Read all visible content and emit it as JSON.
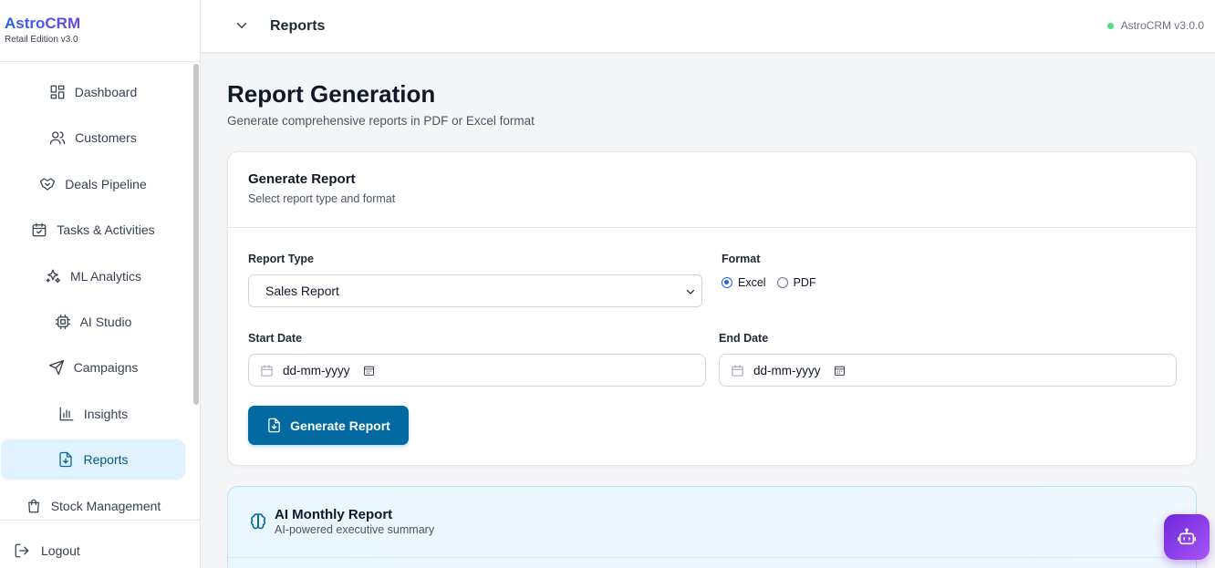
{
  "brand": {
    "title": "AstroCRM",
    "edition": "Retail Edition v3.0"
  },
  "sidebar": {
    "items": [
      {
        "label": "Dashboard",
        "icon": "dashboard-icon",
        "active": false
      },
      {
        "label": "Customers",
        "icon": "users-icon",
        "active": false
      },
      {
        "label": "Deals Pipeline",
        "icon": "handshake-icon",
        "active": false
      },
      {
        "label": "Tasks & Activities",
        "icon": "calendar-check-icon",
        "active": false
      },
      {
        "label": "ML Analytics",
        "icon": "sparkles-icon",
        "active": false
      },
      {
        "label": "AI Studio",
        "icon": "cpu-icon",
        "active": false
      },
      {
        "label": "Campaigns",
        "icon": "send-icon",
        "active": false
      },
      {
        "label": "Insights",
        "icon": "bar-chart-icon",
        "active": false
      },
      {
        "label": "Reports",
        "icon": "file-download-icon",
        "active": true
      },
      {
        "label": "Stock Management",
        "icon": "shopping-bag-icon",
        "active": false
      }
    ],
    "logout_label": "Logout"
  },
  "header": {
    "title": "Reports",
    "version": "AstroCRM v3.0.0",
    "status_color": "#4ade80"
  },
  "page": {
    "title": "Report Generation",
    "subtitle": "Generate comprehensive reports in PDF or Excel format"
  },
  "generate_card": {
    "title": "Generate Report",
    "subtitle": "Select report type and format",
    "report_type_label": "Report Type",
    "report_type_value": "Sales Report",
    "format_label": "Format",
    "format_options": [
      {
        "label": "Excel",
        "checked": true
      },
      {
        "label": "PDF",
        "checked": false
      }
    ],
    "start_date_label": "Start Date",
    "start_date_placeholder": "dd-mm-yyyy",
    "end_date_label": "End Date",
    "end_date_placeholder": "dd-mm-yyyy",
    "button_label": "Generate Report"
  },
  "ai_card": {
    "title": "AI Monthly Report",
    "subtitle": "AI-powered executive summary"
  },
  "colors": {
    "accent": "#0369a1",
    "active_bg": "#e0f2fe",
    "fab": "#7c3aed"
  }
}
